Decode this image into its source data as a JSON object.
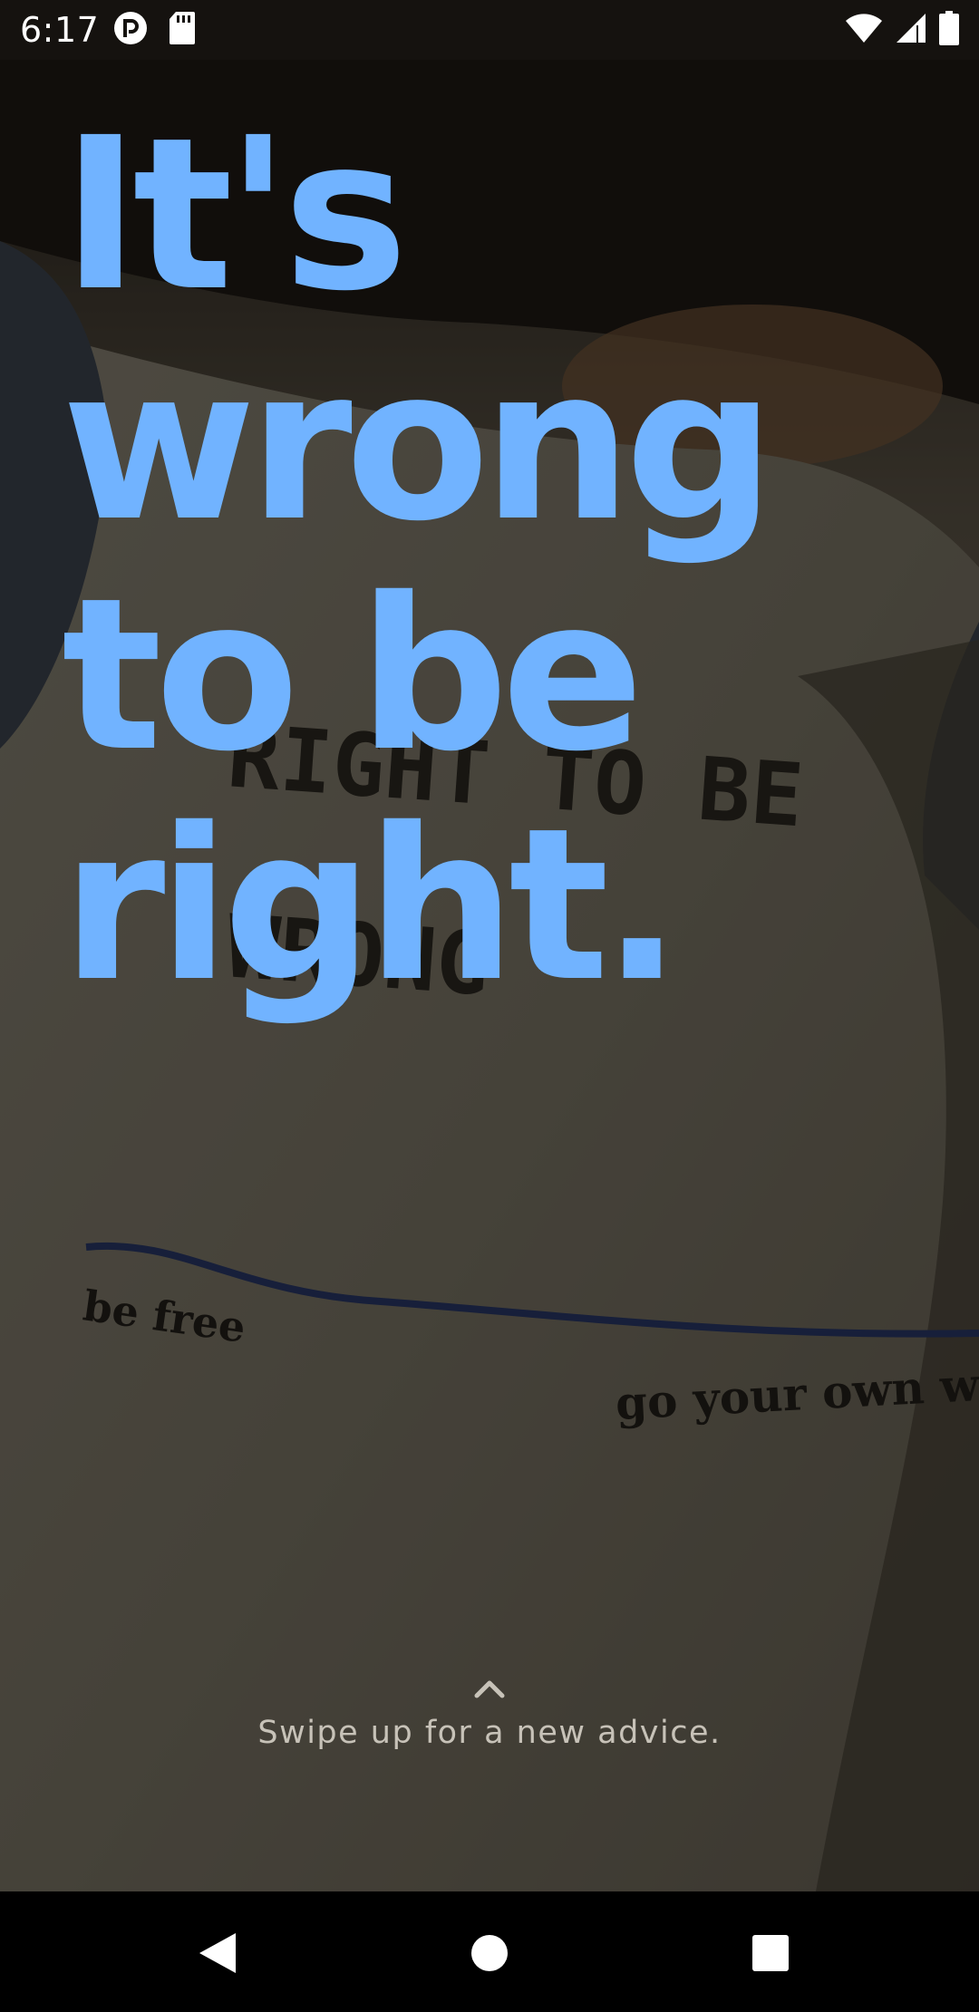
{
  "status_bar": {
    "time": "6:17",
    "left_icons": [
      "notification-app-icon",
      "sd-card-icon"
    ],
    "right_icons": [
      "wifi-icon",
      "cellular-signal-icon",
      "battery-icon"
    ]
  },
  "advice": {
    "lines": [
      "It's",
      "wrong",
      "to be",
      "right."
    ],
    "color": "#71b3ff"
  },
  "background_photo": {
    "shirt_print_lines": [
      "RIGHT TO BE",
      "WRONG"
    ],
    "shirt_small_text": [
      "be free",
      "go your own wa"
    ]
  },
  "swipe_hint": {
    "icon": "chevron-up-icon",
    "text": "Swipe up for a new advice."
  },
  "nav_bar": {
    "buttons": [
      "back-icon",
      "home-icon",
      "recents-icon"
    ]
  }
}
